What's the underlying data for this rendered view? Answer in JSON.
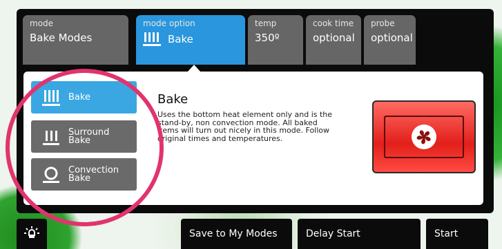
{
  "tabs": [
    {
      "sub": "mode",
      "value": "Bake Modes"
    },
    {
      "sub": "mode option",
      "value": "Bake"
    },
    {
      "sub": "temp",
      "value": "350º"
    },
    {
      "sub": "cook time",
      "value": "optional"
    },
    {
      "sub": "probe",
      "value": "optional"
    }
  ],
  "options": [
    {
      "label1": "Bake",
      "label2": ""
    },
    {
      "label1": "Surround",
      "label2": "Bake"
    },
    {
      "label1": "Convection",
      "label2": "Bake"
    }
  ],
  "description": {
    "title": "Bake",
    "lines": [
      "Uses the bottom heat element only and is the",
      "stand-by, non convection mode. All baked",
      "items will turn out nicely in this mode. Follow",
      "original times and temperatures."
    ]
  },
  "bottom": {
    "save": "Save to My Modes",
    "delay": "Delay Start",
    "start": "Start"
  },
  "colors": {
    "tab_active": "#2a96dd",
    "option_active": "#3aa7e2",
    "fan_button": "#e21f1b",
    "highlight": "#e1346d"
  },
  "icons": [
    "bake-icon",
    "surround-bake-icon",
    "convection-bake-icon",
    "fan-icon",
    "light-icon"
  ]
}
